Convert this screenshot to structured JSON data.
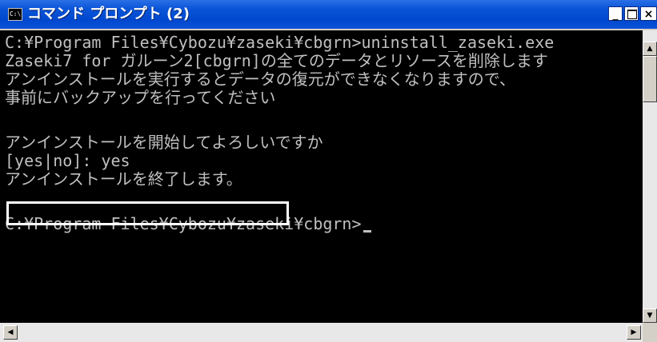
{
  "window": {
    "title": "コマンド プロンプト (2)",
    "icon_label": "C:\\",
    "minimize_label": "_",
    "close_label": "×"
  },
  "console": {
    "lines": [
      "C:¥Program Files¥Cybozu¥zaseki¥cbgrn>uninstall_zaseki.exe",
      "Zaseki7 for ガルーン2[cbgrn]の全てのデータとリソースを削除します",
      "アンインストールを実行するとデータの復元ができなくなりますので、",
      "事前にバックアップを行ってください",
      "",
      "アンインストールを開始してよろしいですか",
      "[yes|no]: yes",
      "アンインストールを終了します。",
      "",
      "C:¥Program Files¥Cybozu¥zaseki¥cbgrn>"
    ]
  },
  "scrollbar": {
    "up_arrow": "▲",
    "down_arrow": "▼",
    "left_arrow": "◀",
    "right_arrow": "▶"
  },
  "colors": {
    "titlebar": "#0a55d8",
    "console_bg": "#000000",
    "console_text": "#c0c0c0"
  }
}
